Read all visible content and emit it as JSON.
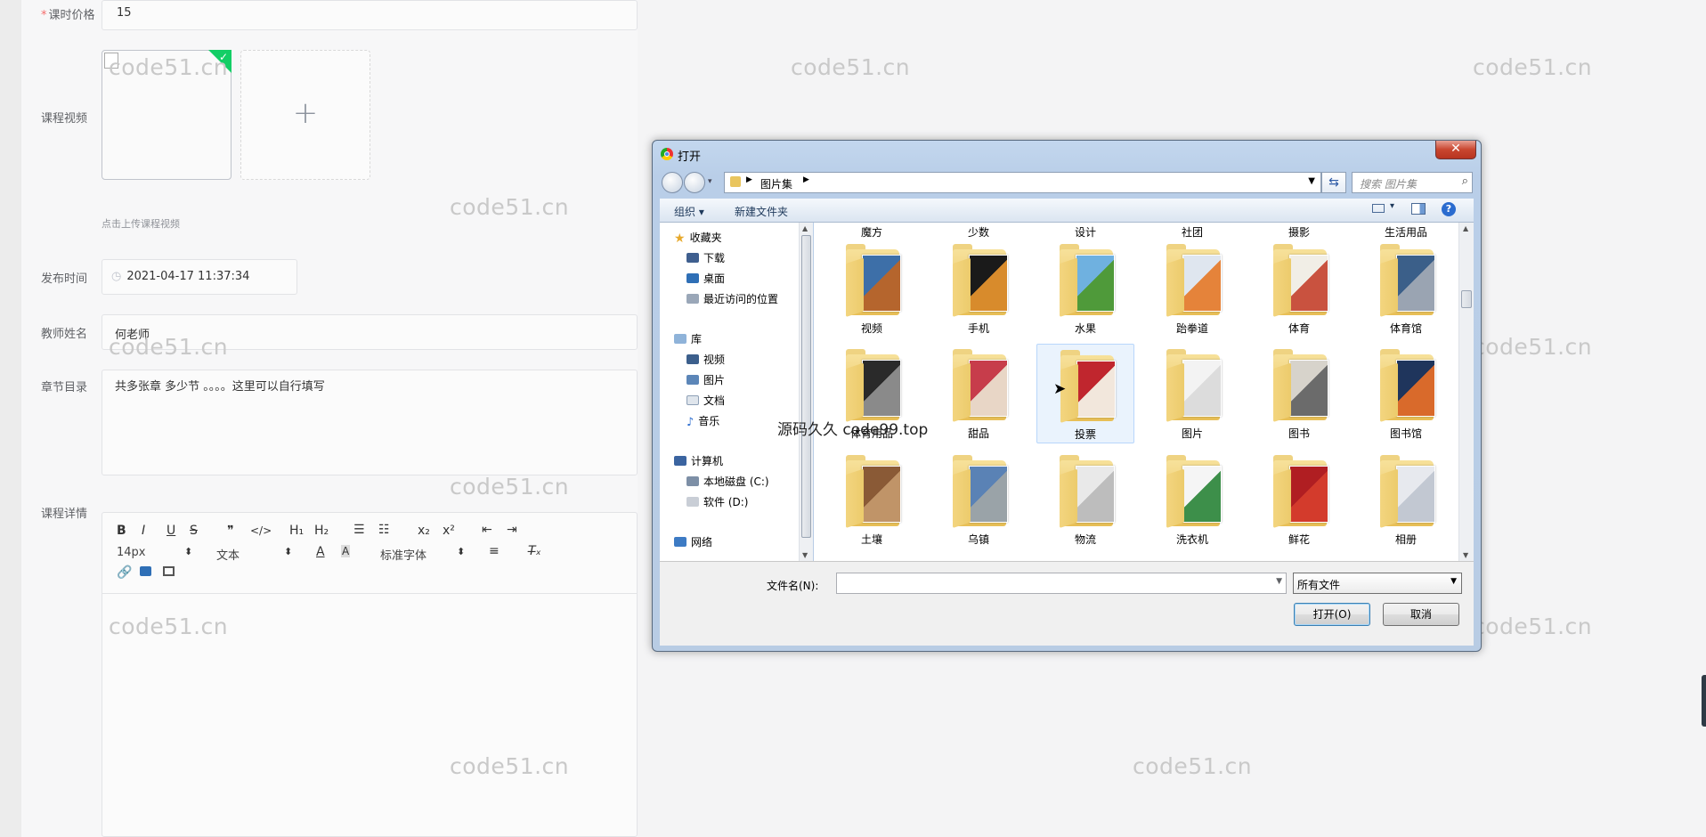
{
  "form": {
    "price_label": "课时价格",
    "price_value": "15",
    "video_label": "课程视频",
    "upload_hint": "点击上传课程视频",
    "publish_label": "发布时间",
    "publish_value": "2021-04-17 11:37:34",
    "teacher_label": "教师姓名",
    "teacher_value": "何老师",
    "chapters_label": "章节目录",
    "chapters_value": "共多张章 多少节 。。。。这里可以自行填写",
    "detail_label": "课程详情",
    "editor": {
      "bold": "B",
      "italic": "I",
      "underline": "U",
      "strike": "S",
      "quote": "❞",
      "code": "</>",
      "h1": "H₁",
      "h2": "H₂",
      "size": "14px",
      "format": "文本",
      "font": "标准字体",
      "sub": "x₂",
      "sup": "x²"
    }
  },
  "watermarks": {
    "text": "code51.cn",
    "stamp": "源码久久 code99.top"
  },
  "dialog": {
    "title": "打开",
    "close_glyph": "✕",
    "breadcrumb": "图片集",
    "search_placeholder": "搜索 图片集",
    "organize": "组织 ▾",
    "new_folder": "新建文件夹",
    "nav": {
      "favorites": "收藏夹",
      "downloads": "下载",
      "desktop": "桌面",
      "recent": "最近访问的位置",
      "library": "库",
      "videos": "视频",
      "pictures": "图片",
      "documents": "文档",
      "music": "音乐",
      "computer": "计算机",
      "drive_c": "本地磁盘 (C:)",
      "drive_d": "软件 (D:)",
      "network": "网络"
    },
    "top_row": [
      "魔方",
      "少数",
      "设计",
      "社团",
      "摄影",
      "生活用品"
    ],
    "folders": [
      {
        "name": "视频",
        "c1": "#3d6fa8",
        "c2": "#b5652d"
      },
      {
        "name": "手机",
        "c1": "#1a1a1a",
        "c2": "#d88b2c"
      },
      {
        "name": "水果",
        "c1": "#6fb1e0",
        "c2": "#4f9a3a"
      },
      {
        "name": "跆拳道",
        "c1": "#dfe6ef",
        "c2": "#e5833a"
      },
      {
        "name": "体育",
        "c1": "#f1eee6",
        "c2": "#c9523f"
      },
      {
        "name": "体育馆",
        "c1": "#3b5f89",
        "c2": "#9aa4b2"
      },
      {
        "name": "体育用品",
        "c1": "#2a2a2a",
        "c2": "#8a8a8a"
      },
      {
        "name": "甜品",
        "c1": "#c73d4b",
        "c2": "#e8d6c6"
      },
      {
        "name": "投票",
        "c1": "#c0262e",
        "c2": "#f2e7dc"
      },
      {
        "name": "图片",
        "c1": "#f3f3f3",
        "c2": "#dcdcdc"
      },
      {
        "name": "图书",
        "c1": "#d7d3cb",
        "c2": "#6b6b6b"
      },
      {
        "name": "图书馆",
        "c1": "#1f355c",
        "c2": "#d96a2b"
      },
      {
        "name": "土壤",
        "c1": "#8a5a36",
        "c2": "#c09468"
      },
      {
        "name": "乌镇",
        "c1": "#5a82b5",
        "c2": "#9aa3a8"
      },
      {
        "name": "物流",
        "c1": "#e9e9e9",
        "c2": "#bdbdbd"
      },
      {
        "name": "洗衣机",
        "c1": "#f5f5f5",
        "c2": "#3d8f4a"
      },
      {
        "name": "鲜花",
        "c1": "#b01e22",
        "c2": "#d33b2c"
      },
      {
        "name": "相册",
        "c1": "#e7e9ee",
        "c2": "#c2c8d2"
      }
    ],
    "filename_label": "文件名(N):",
    "filename_value": "",
    "filetype": "所有文件",
    "open_button": "打开(O)",
    "cancel_button": "取消"
  }
}
